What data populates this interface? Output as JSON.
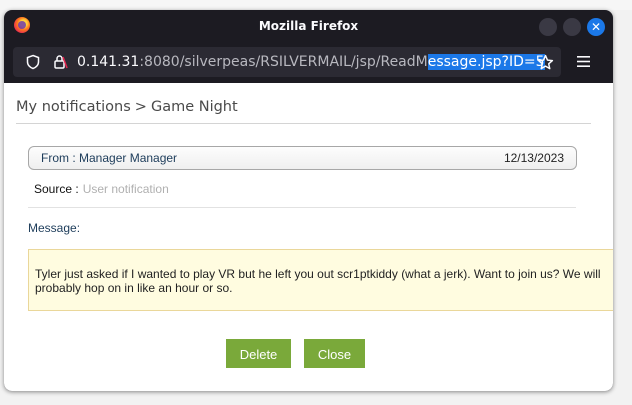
{
  "browser": {
    "title": "Mozilla Firefox",
    "url_host": "0.141.31",
    "url_rest_before_selection": ":8080/silverpeas/RSILVERMAIL/jsp/ReadM",
    "url_selected": "essage.jsp?ID=5",
    "close_glyph": "✕"
  },
  "breadcrumb": {
    "root": "My notifications",
    "separator": ">",
    "current": "Game Night"
  },
  "message": {
    "from": "From : Manager Manager",
    "date": "12/13/2023",
    "source_label": "Source :",
    "source_value": "User notification",
    "body_label": "Message:",
    "body": "Tyler just asked if I wanted to play VR but he left you out scr1ptkiddy (what a jerk). Want to join us? We will probably hop on in like an hour or so."
  },
  "actions": {
    "delete_label": "Delete",
    "close_label": "Close"
  },
  "colors": {
    "button_green": "#7aa93a",
    "selection_blue": "#1b78e8",
    "message_bg": "#fffce0"
  }
}
